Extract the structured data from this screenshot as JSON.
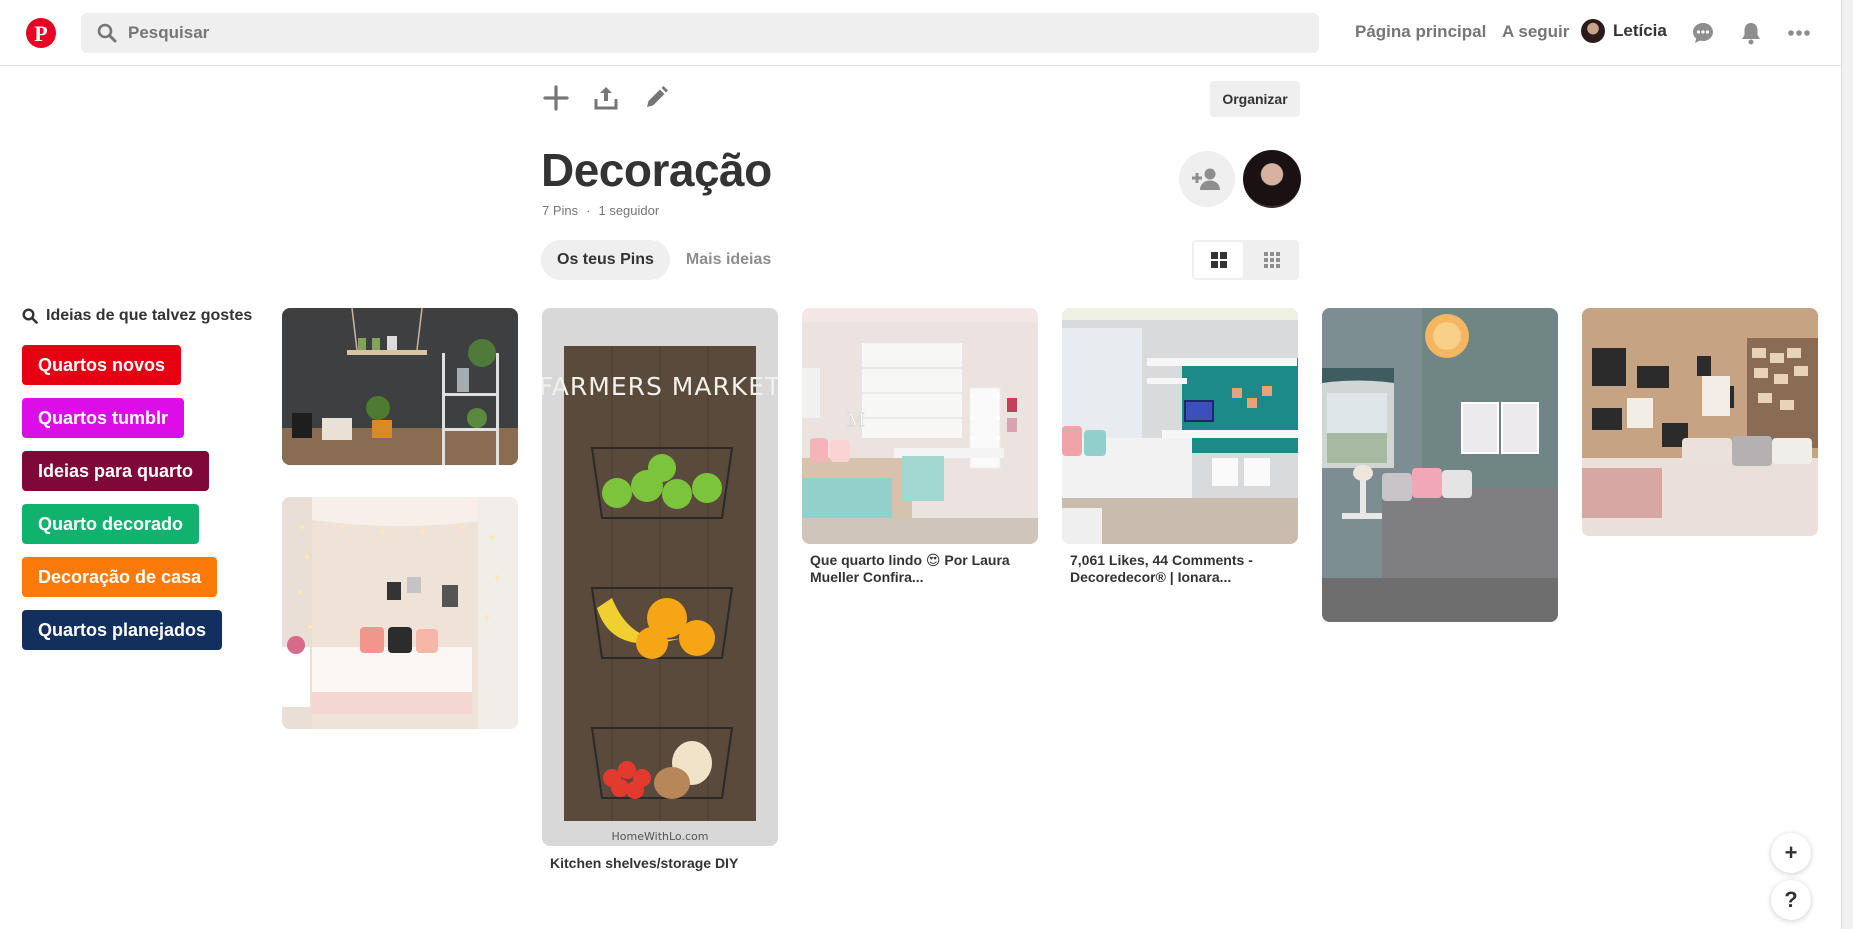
{
  "header": {
    "search_placeholder": "Pesquisar",
    "nav": {
      "home": "Página principal",
      "following": "A seguir"
    },
    "user_name": "Letícia"
  },
  "board": {
    "organize_label": "Organizar",
    "title": "Decoração",
    "pins_count": "7 Pins",
    "followers": "1 seguidor",
    "tabs": [
      "Os teus Pins",
      "Mais ideias"
    ]
  },
  "ideas": {
    "heading": "Ideias de que talvez gostes",
    "chips": [
      {
        "label": "Quartos novos",
        "color": "#e60012"
      },
      {
        "label": "Quartos tumblr",
        "color": "#db0ee8"
      },
      {
        "label": "Ideias para quarto",
        "color": "#7e0837"
      },
      {
        "label": "Quarto decorado",
        "color": "#10b36d"
      },
      {
        "label": "Decoração de casa",
        "color": "#fb7a0a"
      },
      {
        "label": "Quartos planejados",
        "color": "#132f5e"
      }
    ]
  },
  "pins": [
    {
      "caption": ""
    },
    {
      "caption": ""
    },
    {
      "caption": "Kitchen shelves/storage DIY",
      "image_text": "FARMERS MARKET",
      "watermark": "HomeWithLo.com"
    },
    {
      "caption": "Que quarto lindo 😍 Por Laura Mueller Confira..."
    },
    {
      "caption": "7,061 Likes, 44 Comments - Decoredecor® | Ionara..."
    },
    {
      "caption": ""
    },
    {
      "caption": ""
    }
  ],
  "fabs": {
    "add": "+",
    "help": "?"
  }
}
